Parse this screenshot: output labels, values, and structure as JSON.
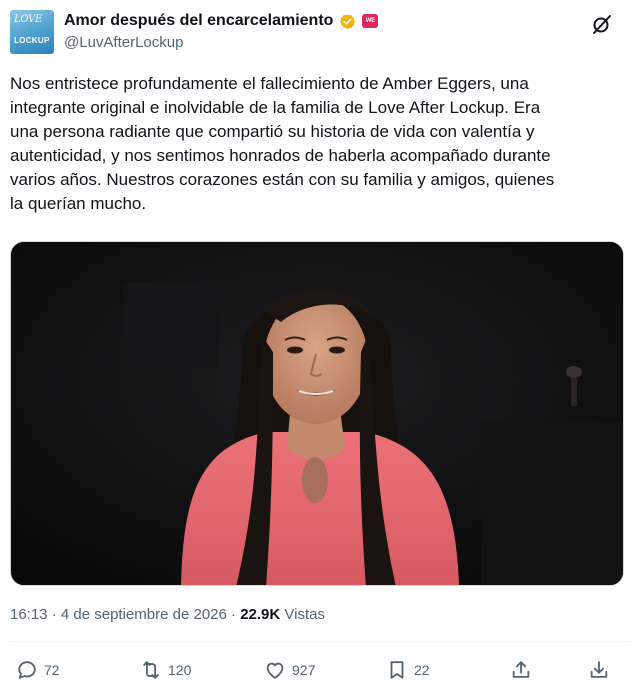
{
  "author": {
    "display_name": "Amor después del encarcelamiento",
    "handle": "@LuvAfterLockup",
    "avatar_line1": "LOVE",
    "avatar_line2": "LOCKUP",
    "affiliate_badge": "WE"
  },
  "tweet": {
    "lines": [
      "Nos entristece profundamente el fallecimiento de Amber Eggers, una",
      "integrante original e inolvidable de la familia de Love After Lockup. Era",
      "una persona radiante que compartió su historia de vida con valentía y",
      "autenticidad, y nos sentimos honrados de haberla acompañado durante",
      "varios años. Nuestros corazones están con su familia y amigos, quienes",
      "la querían mucho."
    ]
  },
  "meta": {
    "time": "16:13",
    "separator": " · ",
    "date": "4 de septiembre de 2026",
    "views_count": "22.9K",
    "views_label": "Vistas"
  },
  "actions": {
    "replies": "72",
    "reposts": "120",
    "likes": "927",
    "bookmarks": "22"
  },
  "colors": {
    "verified": "#f4b400",
    "secondary_text": "#536471",
    "shirt": "#e9686f"
  },
  "icons": {
    "header_action": "grok-icon",
    "reply": "reply-icon",
    "repost": "repost-icon",
    "like": "heart-icon",
    "bookmark": "bookmark-icon",
    "share": "share-icon"
  }
}
